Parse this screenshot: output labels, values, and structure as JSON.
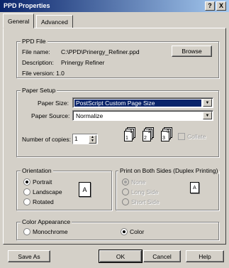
{
  "window": {
    "title": "PPD Properties",
    "help_btn": "?",
    "close_btn": "X"
  },
  "tabs": [
    {
      "label": "General"
    },
    {
      "label": "Advanced"
    }
  ],
  "ppd_file": {
    "group_title": "PPD File",
    "file_name_label": "File name:",
    "file_name_value": "C:\\PPD\\Prinergy_Refiner.ppd",
    "description_label": "Description:",
    "description_value": "Prinergy Refiner",
    "version_label": "File version:",
    "version_value": "1.0",
    "browse_label": "Browse"
  },
  "paper_setup": {
    "group_title": "Paper Setup",
    "paper_size_label": "Paper Size:",
    "paper_size_value": "PostScript Custom Page Size",
    "paper_source_label": "Paper Source:",
    "paper_source_value": "Normalize",
    "copies_label": "Number of copies:",
    "copies_value": "1",
    "collate_label": "Collate",
    "collate_checked": false,
    "page_numbers": [
      "1",
      "1",
      "2",
      "2",
      "3",
      "3"
    ]
  },
  "orientation": {
    "group_title": "Orientation",
    "options": [
      "Portrait",
      "Landscape",
      "Rotated"
    ],
    "selected": "Portrait",
    "preview_letter": "A"
  },
  "duplex": {
    "group_title": "Print on Both Sides (Duplex Printing)",
    "options": [
      "None",
      "Long Side",
      "Short Side"
    ],
    "selected": "None",
    "preview_letter": "A"
  },
  "color": {
    "group_title": "Color Appearance",
    "options": [
      "Monochrome",
      "Color"
    ],
    "selected": "Color"
  },
  "buttons": {
    "save_as": "Save As",
    "ok": "OK",
    "cancel": "Cancel",
    "help": "Help"
  },
  "colors": {
    "titlebar_start": "#0a246a",
    "titlebar_end": "#a6caf0",
    "face": "#d4d0c8",
    "selection": "#0a246a"
  }
}
